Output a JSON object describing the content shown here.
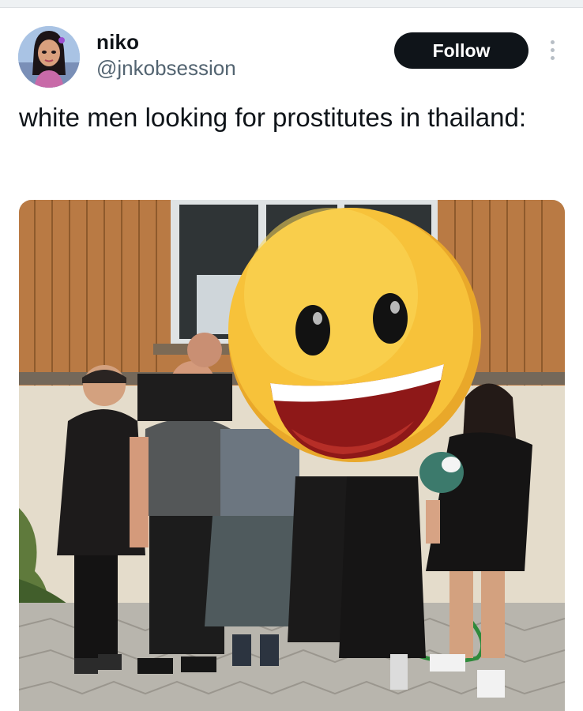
{
  "post": {
    "author": {
      "name": "niko",
      "handle": "@jnkobsession"
    },
    "follow_label": "Follow",
    "text": "white men looking for prostitutes in thailand:"
  },
  "media": {
    "description_icon": "grinning-face-emoji"
  },
  "colors": {
    "follow_bg": "#0f1419",
    "handle": "#536471",
    "emoji_face": "#f7c23a"
  }
}
